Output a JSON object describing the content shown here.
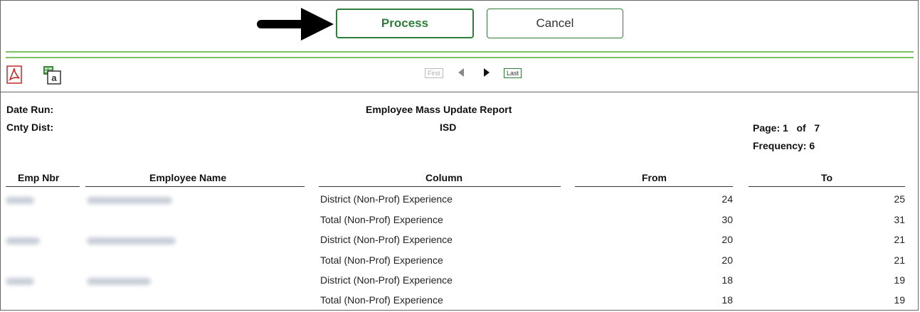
{
  "toolbar": {
    "process_label": "Process",
    "cancel_label": "Cancel"
  },
  "viewer": {
    "first_label": "First",
    "last_label": "Last",
    "xls_letter": "a"
  },
  "report": {
    "date_run_label": "Date Run:",
    "cnty_dist_label": "Cnty Dist:",
    "title": "Employee Mass Update Report",
    "district": "ISD",
    "page_label": "Page:",
    "page_num": "1",
    "of_label": "of",
    "page_total": "7",
    "frequency_label": "Frequency:",
    "frequency_value": "6",
    "columns": {
      "emp_nbr": "Emp Nbr",
      "employee_name": "Employee Name",
      "column": "Column",
      "from": "From",
      "to": "To"
    },
    "rows": [
      {
        "column": "District (Non-Prof) Experience",
        "from": "24",
        "to": "25"
      },
      {
        "column": "Total (Non-Prof) Experience",
        "from": "30",
        "to": "31"
      },
      {
        "column": "District (Non-Prof) Experience",
        "from": "20",
        "to": "21"
      },
      {
        "column": "Total (Non-Prof) Experience",
        "from": "20",
        "to": "21"
      },
      {
        "column": "District (Non-Prof) Experience",
        "from": "18",
        "to": "19"
      },
      {
        "column": "Total (Non-Prof) Experience",
        "from": "18",
        "to": "19"
      }
    ]
  }
}
